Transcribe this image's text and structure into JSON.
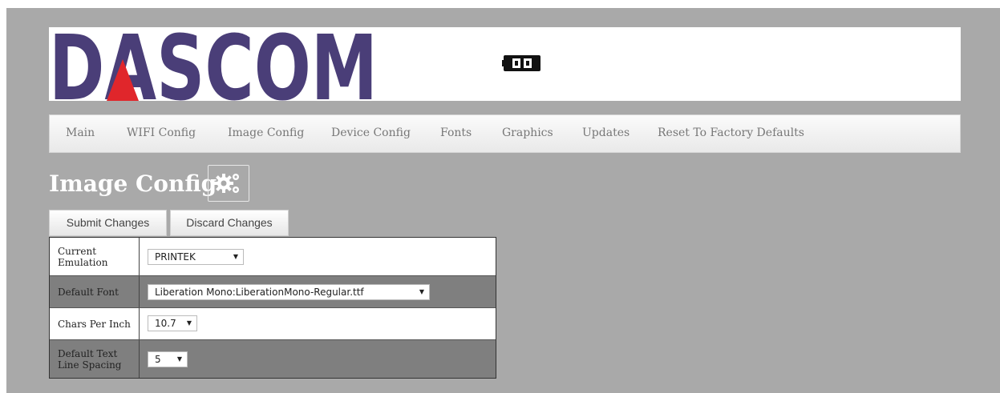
{
  "brand": {
    "logo_text": "DASCOM"
  },
  "header": {
    "status_icon": "battery-icon"
  },
  "nav": {
    "items": [
      {
        "label": "Main"
      },
      {
        "label": "WIFI Config"
      },
      {
        "label": "Image Config"
      },
      {
        "label": "Device Config"
      },
      {
        "label": "Fonts"
      },
      {
        "label": "Graphics"
      },
      {
        "label": "Updates"
      },
      {
        "label": "Reset To Factory Defaults"
      }
    ]
  },
  "page": {
    "title": "Image Config",
    "title_icon": "gears-icon"
  },
  "actions": {
    "submit_label": "Submit Changes",
    "discard_label": "Discard Changes"
  },
  "settings": {
    "rows": [
      {
        "label": "Current Emulation",
        "value": "PRINTEK"
      },
      {
        "label": "Default Font",
        "value": "Liberation Mono:LiberationMono-Regular.ttf"
      },
      {
        "label": "Chars Per Inch",
        "value": "10.7"
      },
      {
        "label": "Default Text Line Spacing",
        "value": "5"
      }
    ]
  },
  "colors": {
    "background": "#a9a9a9",
    "logo_purple": "#4a3e78",
    "logo_red": "#e0262b"
  }
}
